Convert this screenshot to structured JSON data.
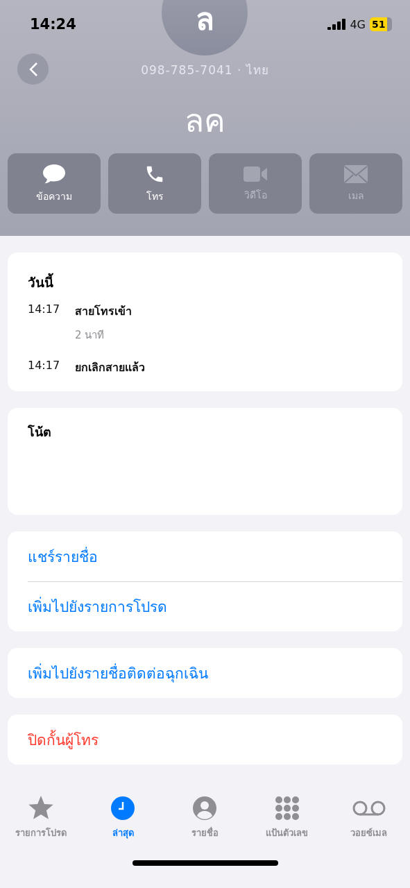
{
  "status_bar": {
    "time": "14:24",
    "network": "4G",
    "battery": "51"
  },
  "contact": {
    "initial": "ล",
    "phone_line": "098-785-7041 · ไทย",
    "name": "ลค"
  },
  "actions": [
    {
      "kind": "message",
      "label": "ข้อความ",
      "enabled": true
    },
    {
      "kind": "call",
      "label": "โทร",
      "enabled": true
    },
    {
      "kind": "video",
      "label": "วิดีโอ",
      "enabled": false
    },
    {
      "kind": "mail",
      "label": "เมล",
      "enabled": false
    }
  ],
  "calls": {
    "heading": "วันนี้",
    "entries": [
      {
        "time": "14:17",
        "label": "สายโทรเข้า",
        "detail": "2 นาที"
      },
      {
        "time": "14:17",
        "label": "ยกเลิกสายแล้ว"
      }
    ]
  },
  "notes": {
    "label": "โน้ต"
  },
  "option_groups": [
    [
      {
        "label": "แชร์รายชื่อ",
        "kind": "normal"
      },
      {
        "label": "เพิ่มไปยังรายการโปรด",
        "kind": "normal"
      }
    ],
    [
      {
        "label": "เพิ่มไปยังรายชื่อติดต่อฉุกเฉิน",
        "kind": "normal"
      }
    ],
    [
      {
        "label": "ปิดกั้นผู้โทร",
        "kind": "destructive"
      }
    ]
  ],
  "tabs": [
    {
      "kind": "favorites",
      "label": "รายการโปรด",
      "selected": false
    },
    {
      "kind": "recents",
      "label": "ล่าสุด",
      "selected": true
    },
    {
      "kind": "contacts",
      "label": "รายชื่อ",
      "selected": false
    },
    {
      "kind": "keypad",
      "label": "แป้นตัวเลข",
      "selected": false
    },
    {
      "kind": "voicemail",
      "label": "วอยซ์เมล",
      "selected": false
    }
  ]
}
